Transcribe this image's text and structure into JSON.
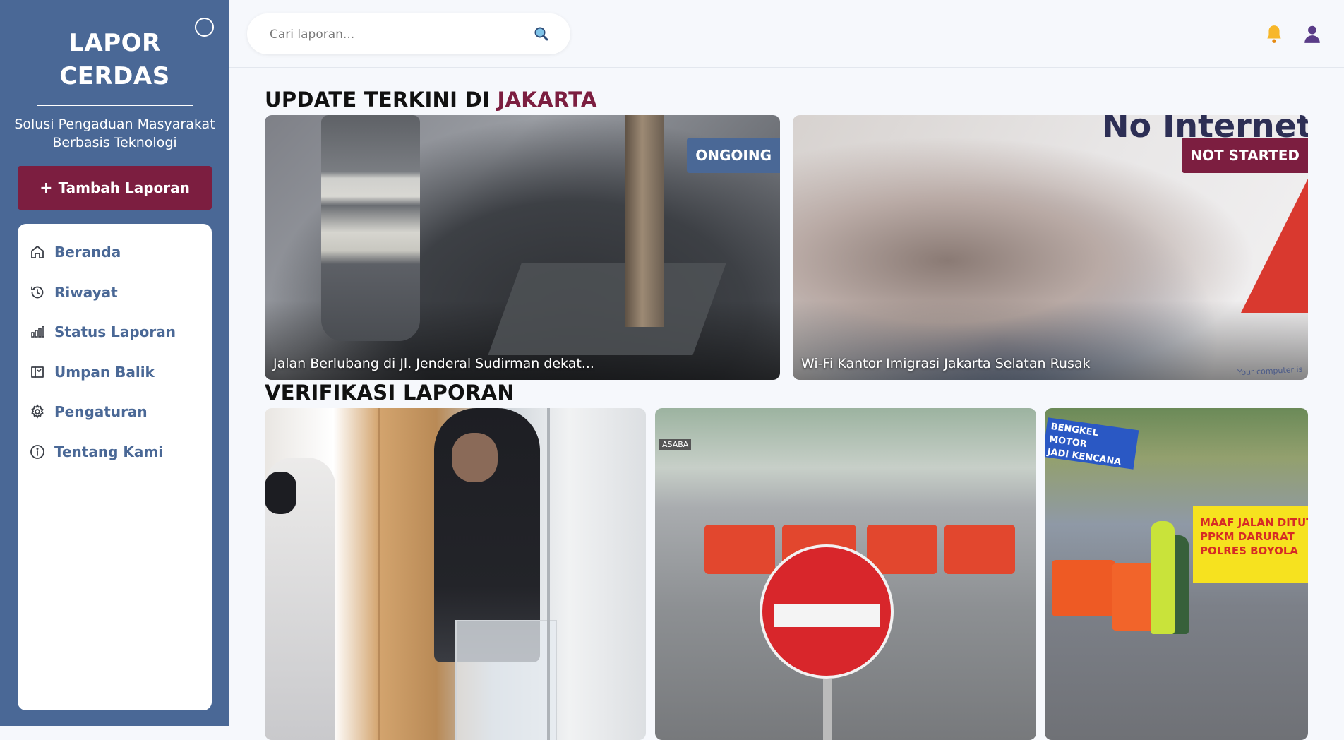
{
  "sidebar": {
    "brand_line1": "LAPOR",
    "brand_line2": "CERDAS",
    "tagline": "Solusi Pengaduan Masyarakat Berbasis Teknologi",
    "add_button_label": "Tambah Laporan",
    "add_button_icon": "+",
    "items": [
      {
        "label": "Beranda",
        "icon": "home-icon"
      },
      {
        "label": "Riwayat",
        "icon": "history-icon"
      },
      {
        "label": "Status Laporan",
        "icon": "bar-chart-icon"
      },
      {
        "label": "Umpan Balik",
        "icon": "feedback-book-icon"
      },
      {
        "label": "Pengaturan",
        "icon": "gear-icon"
      },
      {
        "label": "Tentang Kami",
        "icon": "info-icon"
      }
    ]
  },
  "topbar": {
    "search_placeholder": "Cari laporan...",
    "search_icon": "search-icon",
    "notification_icon": "bell-icon",
    "profile_icon": "user-icon"
  },
  "updates": {
    "title_prefix": "UPDATE TERKINI DI ",
    "title_city": "JAKARTA",
    "cards": [
      {
        "caption": "Jalan Berlubang di Jl. Jenderal Sudirman dekat...",
        "status": "ONGOING"
      },
      {
        "caption": "Wi-Fi Kantor Imigrasi Jakarta Selatan Rusak",
        "status": "NOT STARTED",
        "image_text": "No Internet",
        "image_corner_text": "Your computer is"
      }
    ]
  },
  "verification": {
    "title": "VERIFIKASI LAPORAN",
    "cards": [
      {
        "image": "store-robbery-photo"
      },
      {
        "image": "road-closure-photo",
        "image_text": "ASABA"
      },
      {
        "image": "police-roadblock-photo",
        "image_text_1": "BENGKEL MOTOR",
        "image_text_2": "JADI KENCANA",
        "banner_line1": "MAAF JALAN DITUT",
        "banner_line2": "PPKM DARURAT",
        "banner_line3": "POLRES BOYOLA"
      }
    ]
  },
  "colors": {
    "sidebar": "#4a6896",
    "accent": "#7c1e40",
    "ongoing_badge": "#4a6896",
    "not_started_badge": "#7c1e40"
  }
}
